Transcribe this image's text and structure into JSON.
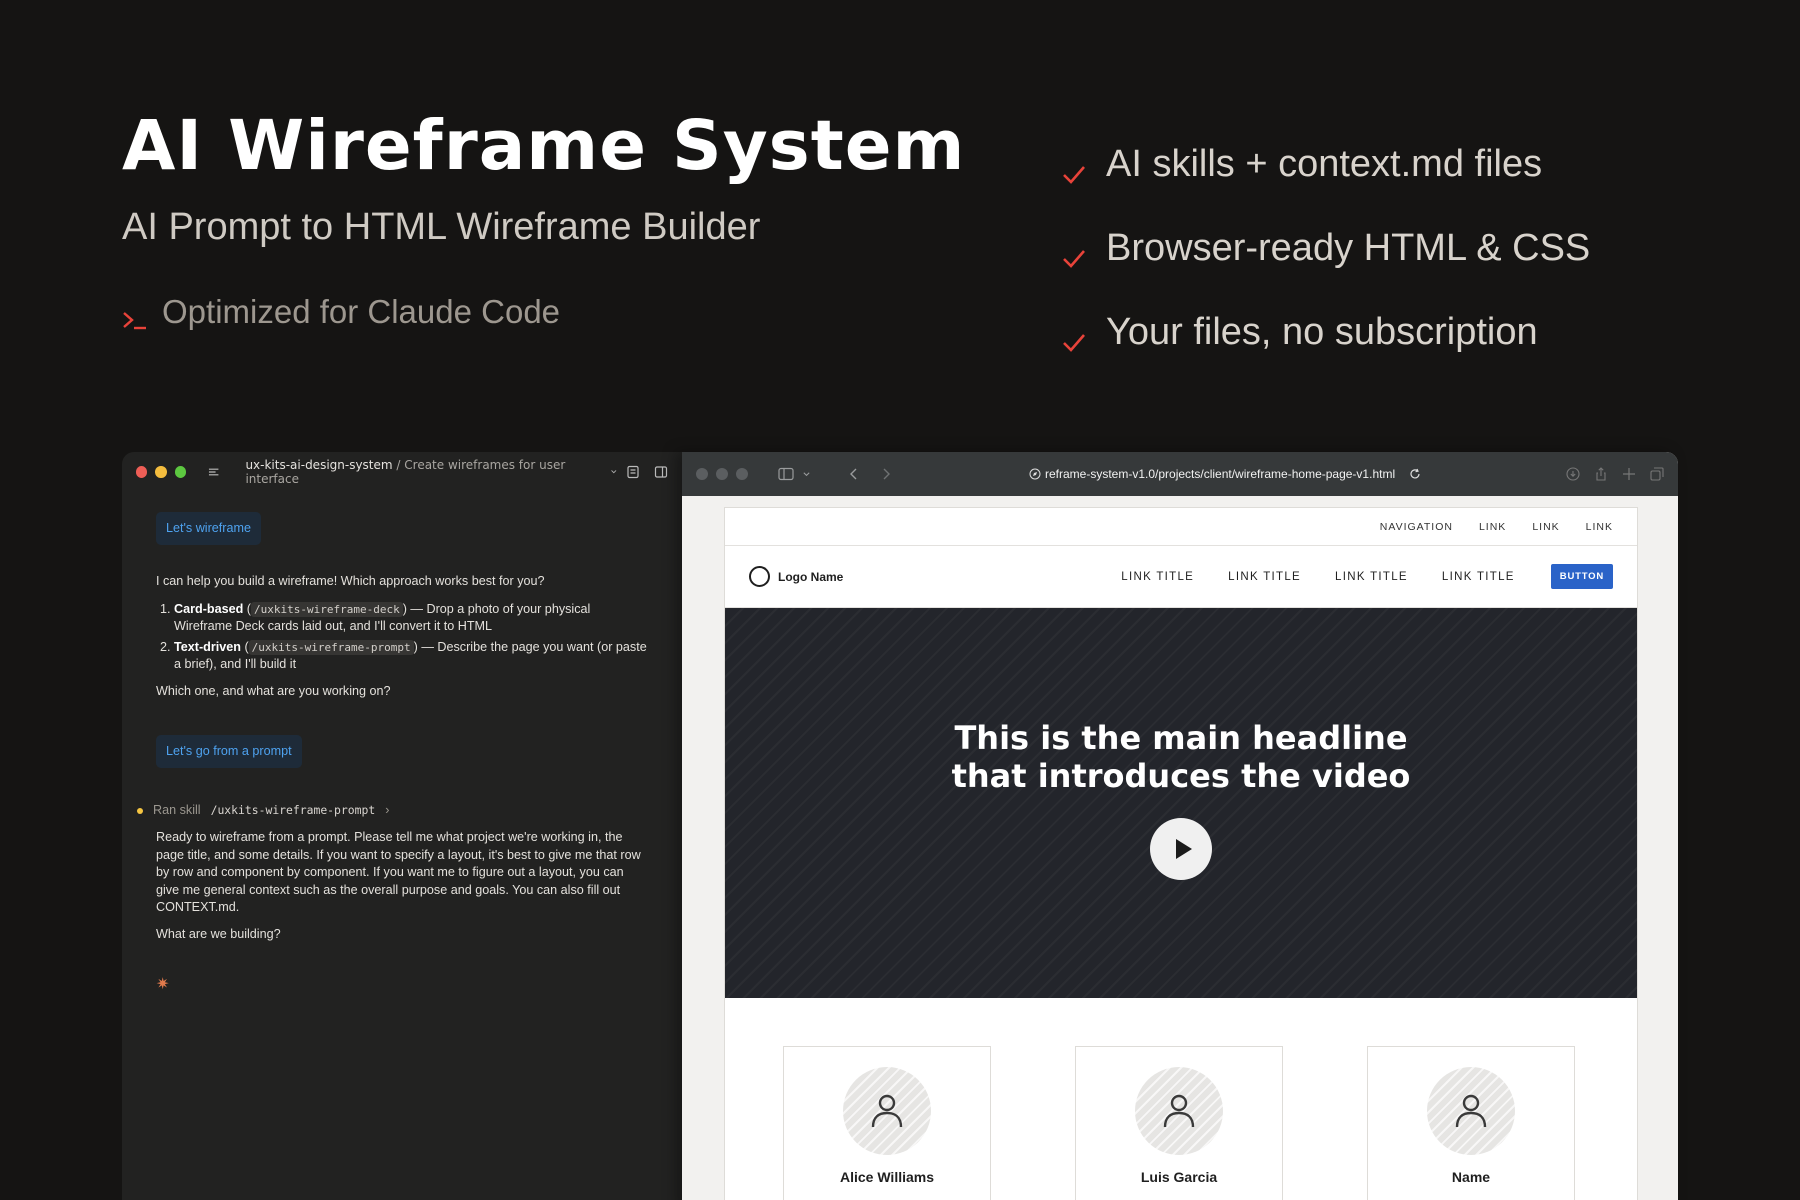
{
  "hero": {
    "title": "AI Wireframe System",
    "subtitle": "AI Prompt to HTML Wireframe Builder",
    "note": "Optimized for Claude Code"
  },
  "features": [
    "AI skills + context.md files",
    "Browser-ready HTML & CSS",
    "Your files, no subscription"
  ],
  "colors": {
    "accent": "#e8433a",
    "button_blue": "#2a63c8",
    "chip_bg": "#1e2b39",
    "chip_text": "#4ea2ef"
  },
  "terminal": {
    "breadcrumb_main": "ux-kits-ai-design-system",
    "breadcrumb_sep": " / ",
    "breadcrumb_sub": "Create wireframes for user interface",
    "chip1": "Let's wireframe",
    "intro": "I can help you build a wireframe! Which approach works best for you?",
    "options": [
      {
        "label": "Card-based",
        "cmd": "/uxkits-wireframe-deck",
        "desc": "— Drop a photo of your physical Wireframe Deck cards laid out, and I'll convert it to HTML"
      },
      {
        "label": "Text-driven",
        "cmd": "/uxkits-wireframe-prompt",
        "desc": "— Describe the page you want (or paste a brief), and I'll build it"
      }
    ],
    "question": "Which one, and what are you working on?",
    "chip2": "Let's go from a prompt",
    "skill_prefix": "Ran skill",
    "skill_cmd": "/uxkits-wireframe-prompt",
    "skill_chevron": "›",
    "reply": "Ready to wireframe from a prompt. Please tell me what project we're working in, the page title, and some details. If you want to specify a layout, it's best to give me that row by row and component by component. If you want me to figure out a layout, you can give me general context such as the overall purpose and goals. You can also fill out CONTEXT.md.",
    "reply_question": "What are we building?",
    "spinner": "✷"
  },
  "browser": {
    "url": "reframe-system-v1.0/projects/client/wireframe-home-page-v1.html",
    "utility_nav": [
      "NAVIGATION",
      "LINK",
      "LINK",
      "LINK"
    ],
    "logo": "Logo Name",
    "main_links": [
      "LINK TITLE",
      "LINK TITLE",
      "LINK TITLE",
      "LINK TITLE"
    ],
    "button": "BUTTON",
    "headline": "This is the main headline that introduces the video",
    "people": [
      "Alice Williams",
      "Luis Garcia",
      "Name"
    ]
  }
}
